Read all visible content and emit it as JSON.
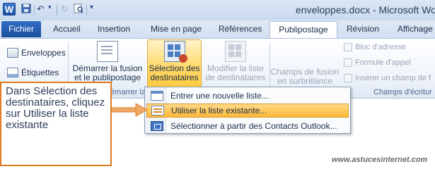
{
  "window": {
    "title": "enveloppes.docx - Microsoft Word"
  },
  "quick_access": {
    "logo_letter": "W",
    "icons": [
      "save-icon",
      "undo-icon",
      "redo-icon",
      "print-preview-icon"
    ],
    "customize_glyph": "▾"
  },
  "tabs": {
    "file": "Fichier",
    "items": [
      "Accueil",
      "Insertion",
      "Mise en page",
      "Références",
      "Publipostage",
      "Révision",
      "Affichage"
    ],
    "active": "Publipostage"
  },
  "ribbon": {
    "creer": {
      "envelopes": "Enveloppes",
      "labels": "Étiquettes"
    },
    "demarrer": {
      "start_line1": "Démarrer la fusion",
      "start_line2": "et le publipostage",
      "group_label": "Démarrer la f"
    },
    "select_recipients": {
      "line1": "Sélection des",
      "line2": "destinataires"
    },
    "modify_list": {
      "line1": "Modifier la liste",
      "line2": "de destinataires"
    },
    "merge_fields": {
      "line1": "Champs de fusion",
      "line2": "en surbrillance"
    },
    "right_group": {
      "address_block": "Bloc d'adresse",
      "greeting": "Formule d'appel",
      "insert_field": "Insérer un champ de f",
      "group_label": "Champs d'écritur"
    }
  },
  "menu": {
    "items": [
      {
        "label": "Entrer une nouvelle liste...",
        "icon": "new-list-icon"
      },
      {
        "label": "Utiliser la liste existante...",
        "icon": "existing-list-icon"
      },
      {
        "label": "Sélectionner à partir des Contacts Outlook...",
        "icon": "outlook-contacts-icon"
      }
    ],
    "selected_index": 1
  },
  "callout": {
    "text": "Dans Sélection des destinataires, cliquez sur Utiliser la liste existante"
  },
  "watermark": "www.astucesinternet.com",
  "colors": {
    "accent_orange": "#e07b22",
    "file_tab_blue": "#1b4f9f",
    "highlight_yellow": "#ffd86a"
  }
}
